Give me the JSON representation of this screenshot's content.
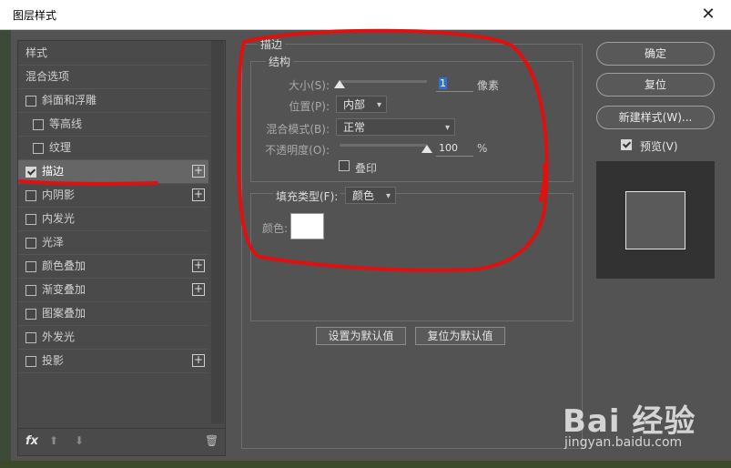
{
  "window": {
    "title": "图层样式",
    "close_glyph": "✕"
  },
  "left_panel": {
    "items": [
      {
        "label": "样式",
        "checkbox": false,
        "checked": false,
        "plus": false,
        "indent": 0
      },
      {
        "label": "混合选项",
        "checkbox": false,
        "checked": false,
        "plus": false,
        "indent": 0
      },
      {
        "label": "斜面和浮雕",
        "checkbox": true,
        "checked": false,
        "plus": false,
        "indent": 0
      },
      {
        "label": "等高线",
        "checkbox": true,
        "checked": false,
        "plus": false,
        "indent": 1
      },
      {
        "label": "纹理",
        "checkbox": true,
        "checked": false,
        "plus": false,
        "indent": 1
      },
      {
        "label": "描边",
        "checkbox": true,
        "checked": true,
        "plus": true,
        "indent": 0,
        "selected": true
      },
      {
        "label": "内阴影",
        "checkbox": true,
        "checked": false,
        "plus": true,
        "indent": 0
      },
      {
        "label": "内发光",
        "checkbox": true,
        "checked": false,
        "plus": false,
        "indent": 0
      },
      {
        "label": "光泽",
        "checkbox": true,
        "checked": false,
        "plus": false,
        "indent": 0
      },
      {
        "label": "颜色叠加",
        "checkbox": true,
        "checked": false,
        "plus": true,
        "indent": 0
      },
      {
        "label": "渐变叠加",
        "checkbox": true,
        "checked": false,
        "plus": true,
        "indent": 0
      },
      {
        "label": "图案叠加",
        "checkbox": true,
        "checked": false,
        "plus": false,
        "indent": 0
      },
      {
        "label": "外发光",
        "checkbox": true,
        "checked": false,
        "plus": false,
        "indent": 0
      },
      {
        "label": "投影",
        "checkbox": true,
        "checked": false,
        "plus": true,
        "indent": 0
      }
    ],
    "bottom": {
      "fx": "fx",
      "up": "⬆",
      "down": "⬇",
      "trash": "🗑"
    },
    "plus_glyph": "+"
  },
  "stroke": {
    "title": "描边",
    "structure": {
      "title": "结构",
      "size_label": "大小(S):",
      "size_value": "1",
      "size_unit": "像素",
      "size_fraction": 0.0,
      "position_label": "位置(P):",
      "position_value": "内部",
      "blend_label": "混合模式(B):",
      "blend_value": "正常",
      "opacity_label": "不透明度(O):",
      "opacity_value": "100",
      "opacity_unit": "%",
      "opacity_fraction": 1.0,
      "overprint_label": "叠印"
    },
    "fill": {
      "type_label": "填充类型(F):",
      "type_value": "颜色",
      "color_label": "颜色:",
      "color": "#ffffff"
    },
    "set_default": "设置为默认值",
    "reset_default": "复位为默认值"
  },
  "right": {
    "ok": "确定",
    "reset": "复位",
    "new_style": "新建样式(W)...",
    "preview_label": "预览(V)",
    "preview_checked": true
  },
  "watermark": {
    "brand": "Bai 经验",
    "url": "jingyan.baidu.com"
  },
  "colors": {
    "annotation_red": "#e01010",
    "dialog_bg": "#535353"
  },
  "chevron": "▾"
}
